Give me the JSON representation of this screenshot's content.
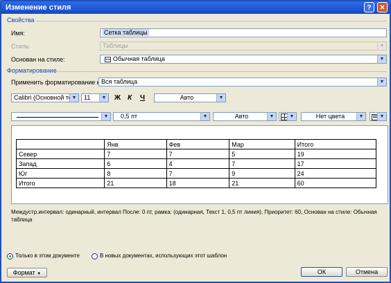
{
  "window": {
    "title": "Изменение стиля",
    "help": "?",
    "close": "✕"
  },
  "properties": {
    "section": "Свойства",
    "name_label": "Имя:",
    "name_value": "Сетка таблицы",
    "style_label": "Стиль:",
    "style_value": "Таблицы",
    "based_label": "Основан на стиле:",
    "based_value": "Обычная таблица"
  },
  "formatting": {
    "section": "Форматирование",
    "apply_label": "Применить форматирование к:",
    "apply_value": "Вся таблица",
    "font": "Calibri (Основной текс",
    "size": "11",
    "bold": "Ж",
    "italic": "К",
    "underline": "Ч",
    "font_color": "Авто",
    "line_width": "0,5 пт",
    "border_color": "Авто",
    "shading": "Нет цвета"
  },
  "preview": {
    "header": [
      "",
      "Янв",
      "Фев",
      "Мар",
      "Итого"
    ],
    "rows": [
      [
        "Север",
        "7",
        "7",
        "5",
        "19"
      ],
      [
        "Запад",
        "6",
        "4",
        "7",
        "17"
      ],
      [
        "Юг",
        "8",
        "7",
        "9",
        "24"
      ],
      [
        "Итого",
        "21",
        "18",
        "21",
        "60"
      ]
    ]
  },
  "description": "Междустр.интервал:  одинарный, интервал После:  0 пт, рамка: (одинарная, Текст 1,  0,5 пт линия), Приоритет: 60, Основан на стиле: Обычная таблица",
  "options": {
    "only_doc": "Только в этом документе",
    "new_docs": "В новых документах, использующих этот шаблон"
  },
  "buttons": {
    "format": "Формат",
    "ok": "ОК",
    "cancel": "Отмена"
  },
  "icons": {
    "table": "table-icon",
    "borders": "borders-icon",
    "align": "align-icon"
  },
  "colors": {
    "titlebar": "#1348c6",
    "section": "#1a45b2",
    "dialog": "#ece9d8"
  }
}
